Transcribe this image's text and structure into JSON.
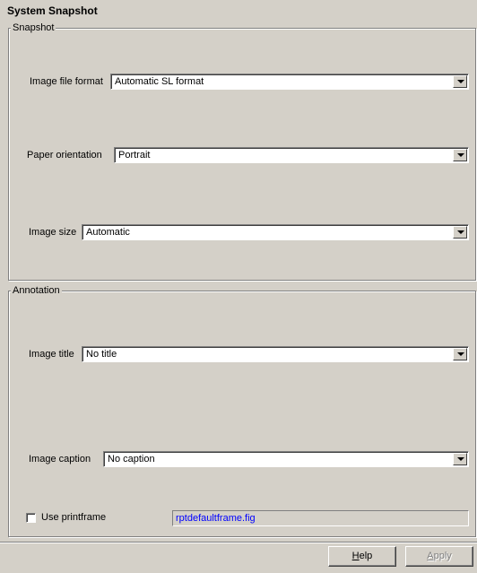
{
  "panel": {
    "title": "System Snapshot"
  },
  "snapshot": {
    "group_label": "Snapshot",
    "image_file_format": {
      "label": "Image file format",
      "value": "Automatic SL format"
    },
    "paper_orientation": {
      "label": "Paper orientation",
      "value": "Portrait"
    },
    "image_size": {
      "label": "Image size",
      "value": "Automatic"
    }
  },
  "annotation": {
    "group_label": "Annotation",
    "image_title": {
      "label": "Image title",
      "value": "No title"
    },
    "image_caption": {
      "label": "Image caption",
      "value": "No caption"
    },
    "use_printframe": {
      "label": "Use printframe",
      "checked": false
    },
    "printframe_file": "rptdefaultframe.fig"
  },
  "buttons": {
    "help": "Help",
    "apply": "Apply"
  },
  "icons": {
    "combo_arrow": "chevron-down-icon",
    "checkbox": "checkbox-icon"
  }
}
